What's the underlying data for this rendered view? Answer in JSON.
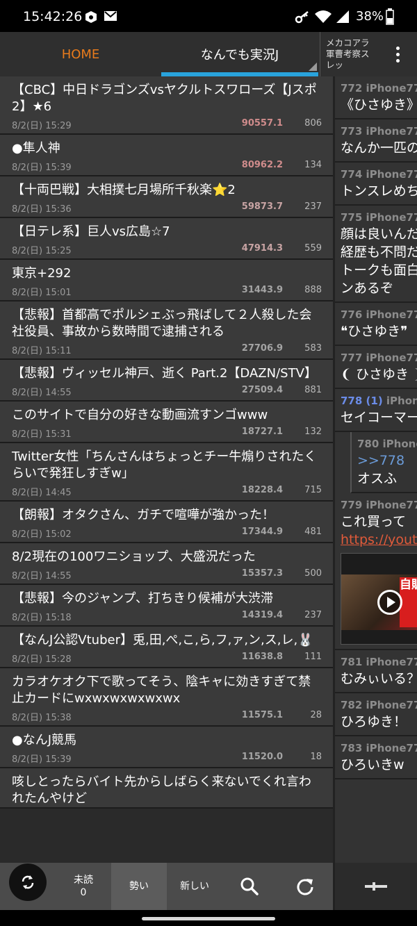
{
  "status_bar": {
    "time": "15:42:26",
    "battery_percent": "38%",
    "icons": [
      "app-notification-icon",
      "mail-icon",
      "key-icon",
      "wifi-icon",
      "signal-icon",
      "battery-icon"
    ]
  },
  "header": {
    "tabs": [
      {
        "label": "HOME",
        "active": false
      },
      {
        "label": "なんでも実況J",
        "active": true
      },
      {
        "label": "メカコアラ軍曹考察スレッ",
        "active": false
      }
    ],
    "menu_icon": "overflow-menu-icon"
  },
  "threads": [
    {
      "title": "【CBC】中日ドラゴンズvsヤクルトスワローズ【Jスポ2】★6",
      "date": "8/2(日) 15:29",
      "speed": "90557.1",
      "count": "806",
      "heat": "hot"
    },
    {
      "title": "●隼人神",
      "date": "8/2(日) 15:39",
      "speed": "80962.2",
      "count": "134",
      "heat": "hot"
    },
    {
      "title": "【十両巴戦】大相撲七月場所千秋楽⭐2",
      "date": "8/2(日) 15:36",
      "speed": "59873.7",
      "count": "237",
      "heat": "warm"
    },
    {
      "title": "【日テレ系】巨人vs広島☆7",
      "date": "8/2(日) 15:25",
      "speed": "47914.3",
      "count": "559",
      "heat": "warm"
    },
    {
      "title": "東京+292",
      "date": "8/2(日) 15:01",
      "speed": "31443.9",
      "count": "888",
      "heat": "norm"
    },
    {
      "title": "【悲報】首都高でポルシェぶっ飛ばして２人殺した会社役員、事故から数時間で逮捕される",
      "date": "8/2(日) 15:11",
      "speed": "27706.9",
      "count": "583",
      "heat": "norm"
    },
    {
      "title": "【悲報】ヴィッセル神戸、逝く Part.2【DAZN/STV】",
      "date": "8/2(日) 14:55",
      "speed": "27509.4",
      "count": "881",
      "heat": "norm"
    },
    {
      "title": "このサイトで自分の好きな動画流すンゴwww",
      "date": "8/2(日) 15:31",
      "speed": "18727.1",
      "count": "132",
      "heat": "norm"
    },
    {
      "title": "Twitter女性「ちんさんはちょっとチー牛煽りされたくらいで発狂しすぎw」",
      "date": "8/2(日) 14:45",
      "speed": "18228.4",
      "count": "715",
      "heat": "norm"
    },
    {
      "title": "【朗報】オタクさん、ガチで喧嘩が強かった！",
      "date": "8/2(日) 15:02",
      "speed": "17344.9",
      "count": "481",
      "heat": "norm"
    },
    {
      "title": "8/2現在の100ワニショップ、大盛況だった",
      "date": "8/2(日) 14:55",
      "speed": "15357.3",
      "count": "500",
      "heat": "norm"
    },
    {
      "title": "【悲報】今のジャンプ、打ちきり候補が大渋滞",
      "date": "8/2(日) 15:18",
      "speed": "14319.4",
      "count": "237",
      "heat": "norm"
    },
    {
      "title": "【なんJ公認Vtuber】兎,田,ぺ,こ,ら,フ,ァ,ン,ス,レ,🐰",
      "date": "8/2(日) 15:28",
      "speed": "11638.8",
      "count": "111",
      "heat": "norm"
    },
    {
      "title": "カラオケオク下で歌ってそう、陰キャに効きすぎて禁止カードにwxwxwxwxwxwx",
      "date": "8/2(日) 15:38",
      "speed": "11575.1",
      "count": "28",
      "heat": "norm"
    },
    {
      "title": "●なんJ競馬",
      "date": "8/2(日) 15:39",
      "speed": "11520.0",
      "count": "18",
      "heat": "norm"
    },
    {
      "title": "咳しとったらバイト先からしばらく来ないでくれ言われたんやけど",
      "date": "",
      "speed": "",
      "count": "",
      "heat": "norm"
    }
  ],
  "posts": [
    {
      "header": "772 iPhone77",
      "lines": [
        "《ひさゆき》"
      ]
    },
    {
      "header": "773 iPhone77",
      "lines": [
        "なんか一匹の"
      ]
    },
    {
      "header": "774 iPhone77",
      "lines": [
        "トンスレめち"
      ]
    },
    {
      "header": "775 iPhone77",
      "lines": [
        "顔は良いんだ",
        "経歴も不問だ",
        "トークも面白",
        "ンあるぞ"
      ]
    },
    {
      "header": "776 iPhone77",
      "lines": [
        "❝ひさゆき❞"
      ]
    },
    {
      "header": "777 iPhone77",
      "lines": [
        "❨ ひさゆき ❩"
      ]
    },
    {
      "header_num": "778 (1)",
      "header_name": " iPhone",
      "lines": [
        "セイコーマー"
      ]
    },
    {
      "header": "780 iPhone",
      "anchor": ">>778",
      "lines": [
        "オスふ"
      ],
      "nested": true
    },
    {
      "header": "779 iPhone77",
      "lines": [
        "これ買って"
      ],
      "link": "https://yout",
      "thumb_text": "自販機"
    },
    {
      "header": "781 iPhone77",
      "lines": [
        "むみぃいる？"
      ]
    },
    {
      "header": "782 iPhone77",
      "lines": [
        "ひろゆき！"
      ]
    },
    {
      "header": "783 iPhone77",
      "lines": [
        "ひろいきw"
      ]
    }
  ],
  "toolbar": {
    "unread_label": "未読",
    "unread_count": "0",
    "sort_momentum": "勢い",
    "sort_new": "新しい",
    "search_icon": "search-icon",
    "refresh_icon": "refresh-icon",
    "fab_icon": "sync-icon",
    "pane_tool_icon": "slider-icon"
  }
}
